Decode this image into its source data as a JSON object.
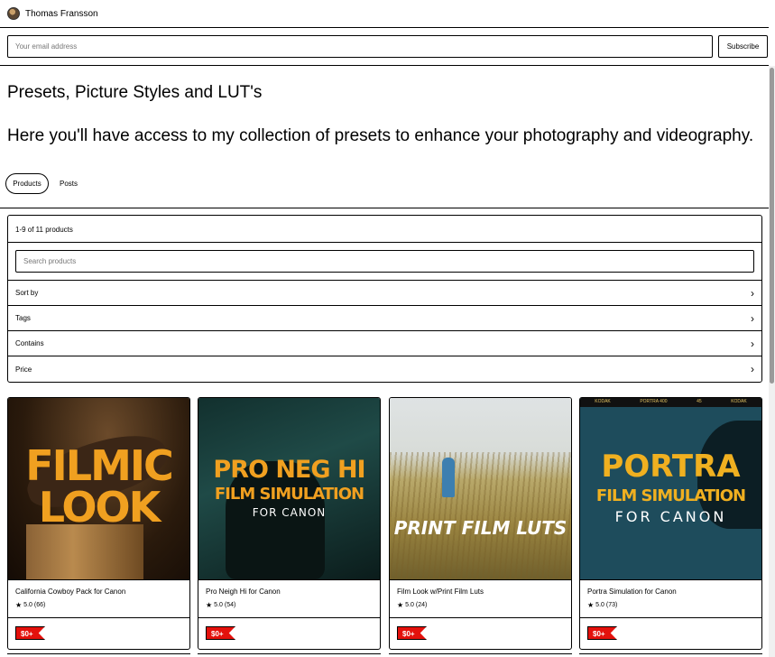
{
  "seller": {
    "name": "Thomas Fransson"
  },
  "subscribe": {
    "placeholder": "Your email address",
    "button": "Subscribe"
  },
  "header": {
    "title": "Presets, Picture Styles and LUT's",
    "description": "Here you'll have access to my collection of presets to enhance your photography and videography.",
    "tabs": [
      {
        "label": "Products",
        "active": true
      },
      {
        "label": "Posts",
        "active": false
      }
    ]
  },
  "filters": {
    "count": "1-9 of 11 products",
    "search_placeholder": "Search products",
    "rows": [
      {
        "label": "Sort by"
      },
      {
        "label": "Tags"
      },
      {
        "label": "Contains"
      },
      {
        "label": "Price"
      }
    ]
  },
  "products": [
    {
      "title": "California Cowboy Pack for Canon",
      "rating": "5.0",
      "reviews": "(66)",
      "price": "$0+",
      "cover": [
        "FILMIC",
        "LOOK"
      ]
    },
    {
      "title": "Pro Neigh Hi for Canon",
      "rating": "5.0",
      "reviews": "(54)",
      "price": "$0+",
      "cover": [
        "PRO NEG HI",
        "FILM SIMULATION",
        "FOR CANON"
      ]
    },
    {
      "title": "Film Look w/Print Film Luts",
      "rating": "5.0",
      "reviews": "(24)",
      "price": "$0+",
      "cover": [
        "PRINT FILM LUTS"
      ]
    },
    {
      "title": "Portra Simulation for Canon",
      "rating": "5.0",
      "reviews": "(73)",
      "price": "$0+",
      "cover": [
        "PORTRA",
        "FILM SIMULATION",
        "FOR CANON"
      ],
      "strip": [
        "KODAK",
        "PORTRA 400",
        "45",
        "KODAK"
      ]
    }
  ],
  "colors": {
    "price_tag": "#e4110c",
    "cover_accent": "#f0a020"
  },
  "icons": {
    "chevron": "chevron-right-icon",
    "star": "star-icon"
  }
}
